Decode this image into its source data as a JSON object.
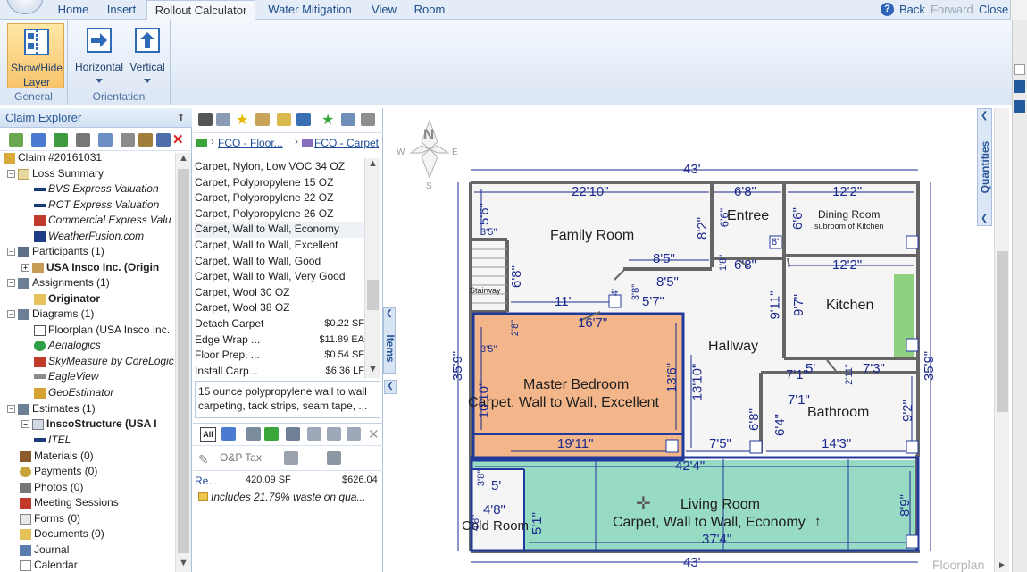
{
  "menu": {
    "tabs": [
      "Home",
      "Insert",
      "Rollout Calculator",
      "Water Mitigation",
      "View",
      "Room"
    ],
    "back": "Back",
    "forward": "Forward",
    "close": "Close"
  },
  "ribbon": {
    "general": {
      "show_hide_line1": "Show/Hide",
      "show_hide_line2": "Layer",
      "label": "General"
    },
    "orientation": {
      "horizontal": "Horizontal",
      "vertical": "Vertical",
      "label": "Orientation"
    }
  },
  "explorer": {
    "title": "Claim Explorer",
    "tree": [
      "Claim #20161031",
      "Loss Summary",
      "BVS Express Valuation",
      "RCT Express Valuation",
      "Commercial Express Valu",
      "WeatherFusion.com",
      "Participants (1)",
      "USA Insco Inc. (Origin",
      "Assignments (1)",
      "Originator",
      "Diagrams (1)",
      "Floorplan (USA Insco Inc.",
      "Aerialogics",
      "SkyMeasure by CoreLogic",
      "EagleView",
      "GeoEstimator",
      "Estimates (1)",
      "InscoStructure (USA I",
      "ITEL",
      "Materials (0)",
      "Payments (0)",
      "Photos (0)",
      "Meeting Sessions",
      "Forms (0)",
      "Documents (0)",
      "Journal",
      "Calendar"
    ]
  },
  "items_panel": {
    "breadcrumb_1": "FCO - Floor...",
    "breadcrumb_2": "FCO - Carpet",
    "items": [
      {
        "name": "Carpet, Nylon, Low VOC 34 OZ",
        "price": ""
      },
      {
        "name": "Carpet, Polypropylene 15 OZ",
        "price": ""
      },
      {
        "name": "Carpet, Polypropylene 22 OZ",
        "price": ""
      },
      {
        "name": "Carpet, Polypropylene 26 OZ",
        "price": ""
      },
      {
        "name": "Carpet, Wall to Wall, Economy",
        "price": ""
      },
      {
        "name": "Carpet, Wall to Wall, Excellent",
        "price": ""
      },
      {
        "name": "Carpet, Wall to Wall, Good",
        "price": ""
      },
      {
        "name": "Carpet, Wall to Wall, Very Good",
        "price": ""
      },
      {
        "name": "Carpet, Wool 30 OZ",
        "price": ""
      },
      {
        "name": "Carpet, Wool 38 OZ",
        "price": ""
      },
      {
        "name": "Detach Carpet",
        "price": "$0.22 SF"
      },
      {
        "name": "Edge Wrap ...",
        "price": "$11.89 EA"
      },
      {
        "name": "Floor Prep, ...",
        "price": "$0.54 SF"
      },
      {
        "name": "Install Carp...",
        "price": "$6.36 LF"
      }
    ],
    "description": "15 ounce polypropylene wall to wall carpeting, tack strips, seam tape, ...",
    "side_tab": "Items",
    "opt_tax": "O&P Tax",
    "line_item": {
      "name": "Re...",
      "qty": "420.09 SF",
      "total": "$626.04"
    },
    "waste_note": "Includes 21.79% waste on qua..."
  },
  "floorplan": {
    "compass": [
      "N",
      "S",
      "E",
      "W"
    ],
    "rooms": {
      "family_room": "Family Room",
      "entree": "Entree",
      "dining_room": "Dining Room",
      "dining_sub": "subroom of Kitchen",
      "kitchen": "Kitchen",
      "hallway": "Hallway",
      "master_bedroom": "Master Bedroom",
      "master_carpet": "Carpet, Wall to Wall, Excellent",
      "bathroom": "Bathroom",
      "living_room": "Living Room",
      "living_carpet": "Carpet, Wall to Wall, Economy",
      "cold_room": "Cold Room",
      "stairway": "Stairway"
    },
    "dims": [
      "43'",
      "22'10\"",
      "6'8\"",
      "12'2\"",
      "5'6\"",
      "8'2\"",
      "6'6\"",
      "6'6\"",
      "8'5\"",
      "1'8\"",
      "6'8\"",
      "12'2\"",
      "8'5\"",
      "6'8\"",
      "11'",
      "5'7\"",
      "3'8\"",
      "4'",
      "9'11\"",
      "9'7\"",
      "16'7\"",
      "2'8\"",
      "13'6\"",
      "13'10\"",
      "10'10\"",
      "7'1\"",
      "5'",
      "7'3\"",
      "2'11\"",
      "7'1\"",
      "6'8\"",
      "6'4\"",
      "9'2\"",
      "19'11\"",
      "7'5\"",
      "14'3\"",
      "42'4\"",
      "5'",
      "3'8\"",
      "4'8\"",
      "4'8\"",
      "5'1\"",
      "37'4\"",
      "8'9\"",
      "43'",
      "35'9\"",
      "35'9\"",
      "3'5\"",
      "3'5\"",
      "8'"
    ],
    "footer": "Floorplan",
    "quantities_tab": "Quantities"
  }
}
